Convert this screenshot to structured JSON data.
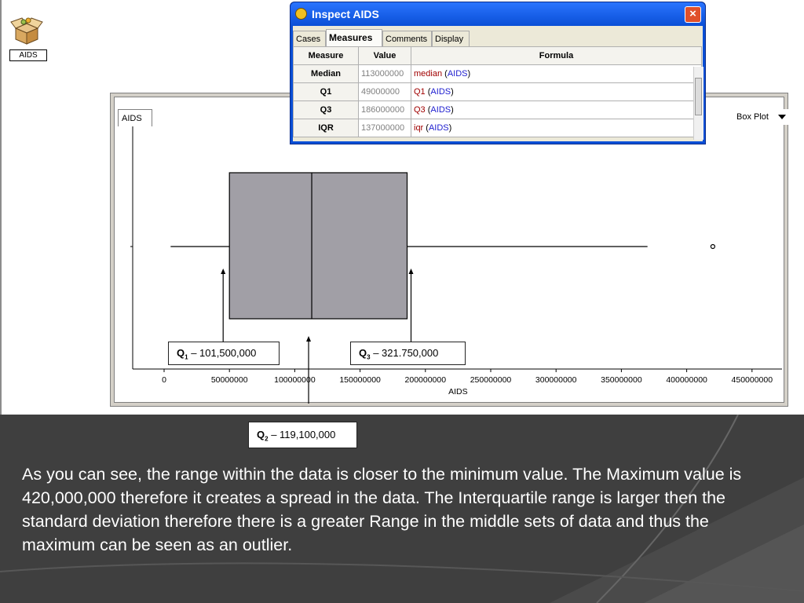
{
  "collection": {
    "label": "AIDS",
    "icon": "box-icon"
  },
  "graph": {
    "tag": "AIDS",
    "plot_type": "Box Plot",
    "x_axis_label": "AIDS",
    "ticks": [
      "0",
      "50000000",
      "100000000",
      "150000000",
      "200000000",
      "250000000",
      "300000000",
      "350000000",
      "400000000",
      "450000000"
    ]
  },
  "inspector": {
    "title": "Inspect AIDS",
    "close": "×",
    "tabs": [
      "Cases",
      "Measures",
      "Comments",
      "Display"
    ],
    "active_tab": "Measures",
    "columns": [
      "Measure",
      "Value",
      "Formula"
    ],
    "rows": [
      {
        "measure": "Median",
        "value": "113000000",
        "fn": "median",
        "arg": "AIDS"
      },
      {
        "measure": "Q1",
        "value": "49000000",
        "fn": "Q1",
        "arg": "AIDS"
      },
      {
        "measure": "Q3",
        "value": "186000000",
        "fn": "Q3",
        "arg": "AIDS"
      },
      {
        "measure": "IQR",
        "value": "137000000",
        "fn": "iqr",
        "arg": "AIDS"
      }
    ]
  },
  "chart_data": {
    "type": "box",
    "xlabel": "AIDS",
    "xlim": [
      0,
      470000000
    ],
    "series": [
      {
        "whisker_low": 5000000,
        "q1": 50000000,
        "median": 113000000,
        "q3": 186000000,
        "whisker_high": 370000000,
        "outliers": [
          420000000
        ]
      }
    ]
  },
  "callouts": {
    "q1": {
      "label": "Q",
      "sub": "1",
      "text": " –   101,500,000"
    },
    "q3": {
      "label": "Q",
      "sub": "3",
      "text": " – 321.750,000"
    },
    "q2": {
      "label": "Q",
      "sub": "2",
      "text": " – 119,100,000"
    }
  },
  "description": "As you can see, the range within the data is closer to the minimum value. The Maximum value is 420,000,000 therefore it creates a spread in the data. The Interquartile range is larger then the standard deviation therefore there is a greater Range in the middle sets of data and thus the maximum can be seen as an outlier."
}
